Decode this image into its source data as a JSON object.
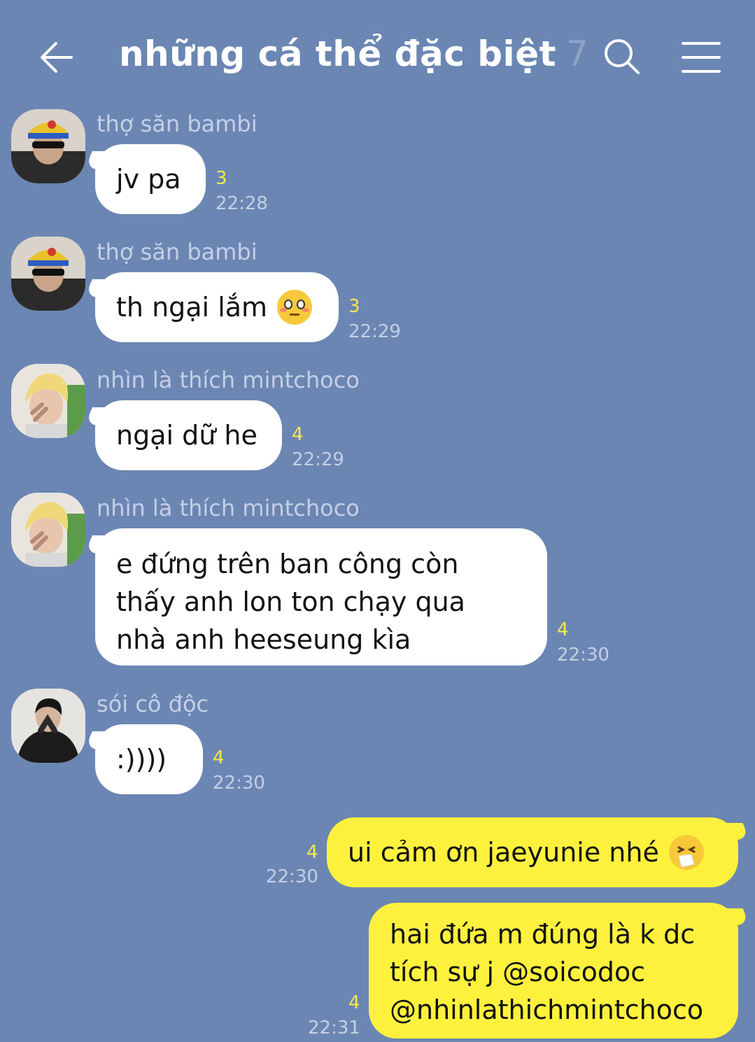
{
  "header": {
    "title": "những cá thể đặc biệt",
    "member_count": "7"
  },
  "messages": [
    {
      "sender": "thợ săn bambi",
      "text": "jv pa",
      "unread": "3",
      "time": "22:28",
      "avatar": "avatar-yellow-cap"
    },
    {
      "sender": "thợ săn bambi",
      "text": "th ngại lắm",
      "unread": "3",
      "time": "22:29",
      "avatar": "avatar-yellow-cap",
      "emoji": "flushed-face-emoji"
    },
    {
      "sender": "nhìn là thích mintchoco",
      "text": "ngại dữ he",
      "unread": "4",
      "time": "22:29",
      "avatar": "avatar-blonde"
    },
    {
      "sender": "nhìn là thích mintchoco",
      "lines": [
        "e đứng trên ban công còn",
        "thấy anh lon ton chạy qua",
        "nhà anh heeseung kìa"
      ],
      "unread": "4",
      "time": "22:30",
      "avatar": "avatar-blonde"
    },
    {
      "sender": "sói cô độc",
      "text": ":))))",
      "unread": "4",
      "time": "22:30",
      "avatar": "avatar-dark-jacket"
    }
  ],
  "my_messages": [
    {
      "text": "ui cảm ơn jaeyunie nhé",
      "unread": "4",
      "time": "22:30",
      "emoji": "sneezing-face-emoji"
    },
    {
      "lines": [
        "hai đứa m đúng là k dc",
        "tích sự j @soicodoc",
        "@nhinlathichmintchoco"
      ],
      "unread": "4",
      "time": "22:31"
    }
  ],
  "colors": {
    "background": "#6b86b3",
    "my_bubble": "#fef13e",
    "their_bubble": "#ffffff",
    "unread": "#f6e84a"
  }
}
